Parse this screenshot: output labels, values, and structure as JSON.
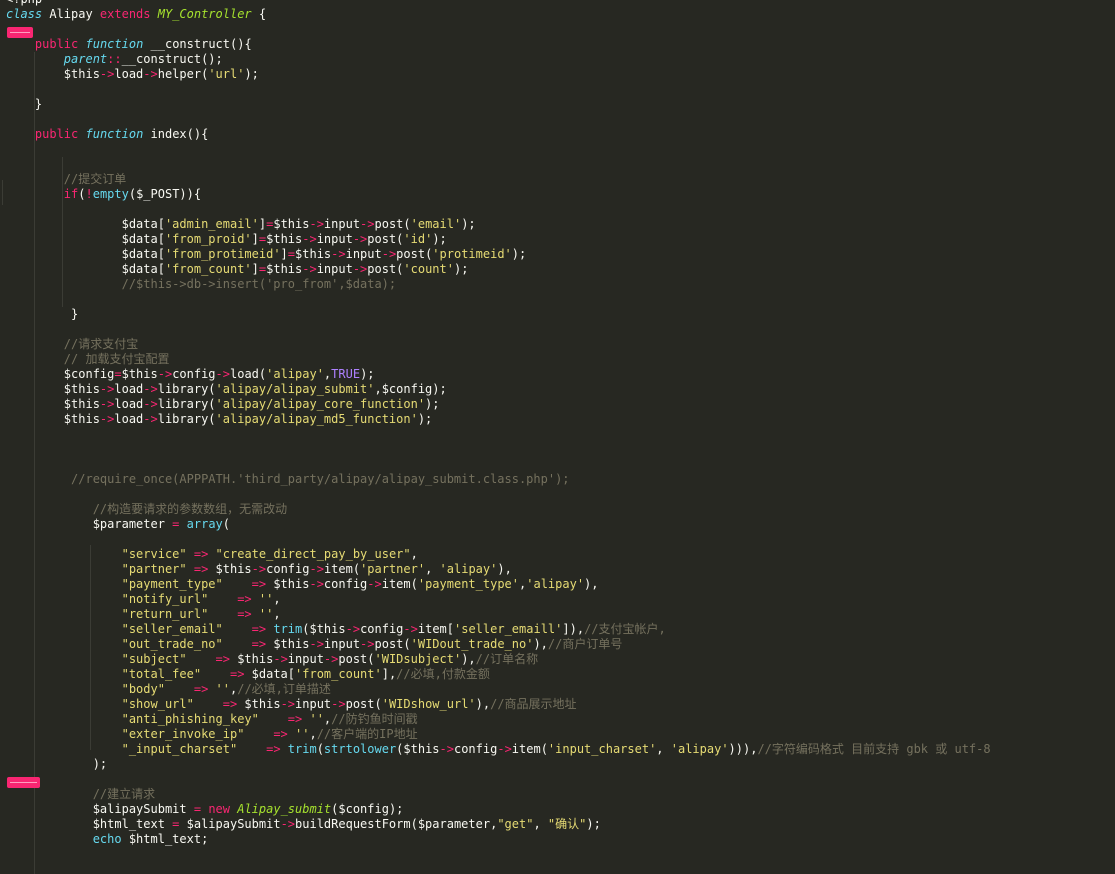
{
  "editor": {
    "language": "php",
    "colors": {
      "background": "#272822",
      "text": "#f8f8f2",
      "keyword": "#f92672",
      "storage": "#66d9ef",
      "class_name": "#a6e22e",
      "string": "#e6db74",
      "comment": "#75715e",
      "constant": "#ae81ff",
      "error_marker": "#f92672"
    },
    "error_markers": [
      {
        "line": 3
      },
      {
        "line": 53
      }
    ],
    "lines": [
      [
        [
          "t",
          "<?php"
        ]
      ],
      [
        [
          "st",
          "class"
        ],
        [
          "t",
          " Alipay "
        ],
        [
          "kw",
          "extends"
        ],
        [
          "t",
          " "
        ],
        [
          "cls",
          "MY_Controller"
        ],
        [
          "t",
          " {"
        ]
      ],
      [],
      [
        [
          "t",
          "    "
        ],
        [
          "kw",
          "public"
        ],
        [
          "t",
          " "
        ],
        [
          "st",
          "function"
        ],
        [
          "t",
          " __construct(){"
        ]
      ],
      [
        [
          "t",
          "        "
        ],
        [
          "st",
          "parent"
        ],
        [
          "op",
          "::"
        ],
        [
          "t",
          "__construct();"
        ]
      ],
      [
        [
          "t",
          "        $this"
        ],
        [
          "op",
          "->"
        ],
        [
          "t",
          "load"
        ],
        [
          "op",
          "->"
        ],
        [
          "t",
          "helper("
        ],
        [
          "str",
          "'url'"
        ],
        [
          "t",
          ");"
        ]
      ],
      [],
      [
        [
          "t",
          "    }"
        ]
      ],
      [],
      [
        [
          "t",
          "    "
        ],
        [
          "kw",
          "public"
        ],
        [
          "t",
          " "
        ],
        [
          "st",
          "function"
        ],
        [
          "t",
          " index(){"
        ]
      ],
      [],
      [],
      [
        [
          "t",
          "        "
        ],
        [
          "com",
          "//提交订单"
        ]
      ],
      [
        [
          "t",
          "        "
        ],
        [
          "kw",
          "if"
        ],
        [
          "t",
          "("
        ],
        [
          "op",
          "!"
        ],
        [
          "fn",
          "empty"
        ],
        [
          "t",
          "($_POST)){"
        ]
      ],
      [],
      [
        [
          "t",
          "                $data["
        ],
        [
          "str",
          "'admin_email'"
        ],
        [
          "t",
          "]"
        ],
        [
          "op",
          "="
        ],
        [
          "t",
          "$this"
        ],
        [
          "op",
          "->"
        ],
        [
          "t",
          "input"
        ],
        [
          "op",
          "->"
        ],
        [
          "t",
          "post("
        ],
        [
          "str",
          "'email'"
        ],
        [
          "t",
          ");"
        ]
      ],
      [
        [
          "t",
          "                $data["
        ],
        [
          "str",
          "'from_proid'"
        ],
        [
          "t",
          "]"
        ],
        [
          "op",
          "="
        ],
        [
          "t",
          "$this"
        ],
        [
          "op",
          "->"
        ],
        [
          "t",
          "input"
        ],
        [
          "op",
          "->"
        ],
        [
          "t",
          "post("
        ],
        [
          "str",
          "'id'"
        ],
        [
          "t",
          ");"
        ]
      ],
      [
        [
          "t",
          "                $data["
        ],
        [
          "str",
          "'from_protimeid'"
        ],
        [
          "t",
          "]"
        ],
        [
          "op",
          "="
        ],
        [
          "t",
          "$this"
        ],
        [
          "op",
          "->"
        ],
        [
          "t",
          "input"
        ],
        [
          "op",
          "->"
        ],
        [
          "t",
          "post("
        ],
        [
          "str",
          "'protimeid'"
        ],
        [
          "t",
          ");"
        ]
      ],
      [
        [
          "t",
          "                $data["
        ],
        [
          "str",
          "'from_count'"
        ],
        [
          "t",
          "]"
        ],
        [
          "op",
          "="
        ],
        [
          "t",
          "$this"
        ],
        [
          "op",
          "->"
        ],
        [
          "t",
          "input"
        ],
        [
          "op",
          "->"
        ],
        [
          "t",
          "post("
        ],
        [
          "str",
          "'count'"
        ],
        [
          "t",
          ");"
        ]
      ],
      [
        [
          "t",
          "                "
        ],
        [
          "com",
          "//$this->db->insert('pro_from',$data);"
        ]
      ],
      [],
      [
        [
          "t",
          "         }"
        ]
      ],
      [],
      [
        [
          "t",
          "        "
        ],
        [
          "com",
          "//请求支付宝"
        ]
      ],
      [
        [
          "t",
          "        "
        ],
        [
          "com",
          "// 加载支付宝配置"
        ]
      ],
      [
        [
          "t",
          "        $config"
        ],
        [
          "op",
          "="
        ],
        [
          "t",
          "$this"
        ],
        [
          "op",
          "->"
        ],
        [
          "t",
          "config"
        ],
        [
          "op",
          "->"
        ],
        [
          "t",
          "load("
        ],
        [
          "str",
          "'alipay'"
        ],
        [
          "t",
          ","
        ],
        [
          "const",
          "TRUE"
        ],
        [
          "t",
          ");"
        ]
      ],
      [
        [
          "t",
          "        $this"
        ],
        [
          "op",
          "->"
        ],
        [
          "t",
          "load"
        ],
        [
          "op",
          "->"
        ],
        [
          "t",
          "library("
        ],
        [
          "str",
          "'alipay/alipay_submit'"
        ],
        [
          "t",
          ",$config);"
        ]
      ],
      [
        [
          "t",
          "        $this"
        ],
        [
          "op",
          "->"
        ],
        [
          "t",
          "load"
        ],
        [
          "op",
          "->"
        ],
        [
          "t",
          "library("
        ],
        [
          "str",
          "'alipay/alipay_core_function'"
        ],
        [
          "t",
          ");"
        ]
      ],
      [
        [
          "t",
          "        $this"
        ],
        [
          "op",
          "->"
        ],
        [
          "t",
          "load"
        ],
        [
          "op",
          "->"
        ],
        [
          "t",
          "library("
        ],
        [
          "str",
          "'alipay/alipay_md5_function'"
        ],
        [
          "t",
          ");"
        ]
      ],
      [],
      [],
      [],
      [
        [
          "t",
          "         "
        ],
        [
          "com",
          "//require_once(APPPATH.'third_party/alipay/alipay_submit.class.php');"
        ]
      ],
      [],
      [
        [
          "t",
          "            "
        ],
        [
          "com",
          "//构造要请求的参数数组，无需改动"
        ]
      ],
      [
        [
          "t",
          "            $parameter "
        ],
        [
          "op",
          "="
        ],
        [
          "t",
          " "
        ],
        [
          "fn",
          "array"
        ],
        [
          "t",
          "("
        ]
      ],
      [],
      [
        [
          "t",
          "                "
        ],
        [
          "str",
          "\"service\""
        ],
        [
          "t",
          " "
        ],
        [
          "op",
          "=>"
        ],
        [
          "t",
          " "
        ],
        [
          "str",
          "\"create_direct_pay_by_user\""
        ],
        [
          "t",
          ","
        ]
      ],
      [
        [
          "t",
          "                "
        ],
        [
          "str",
          "\"partner\""
        ],
        [
          "t",
          " "
        ],
        [
          "op",
          "=>"
        ],
        [
          "t",
          " $this"
        ],
        [
          "op",
          "->"
        ],
        [
          "t",
          "config"
        ],
        [
          "op",
          "->"
        ],
        [
          "t",
          "item("
        ],
        [
          "str",
          "'partner'"
        ],
        [
          "t",
          ", "
        ],
        [
          "str",
          "'alipay'"
        ],
        [
          "t",
          "),"
        ]
      ],
      [
        [
          "t",
          "                "
        ],
        [
          "str",
          "\"payment_type\""
        ],
        [
          "t",
          "    "
        ],
        [
          "op",
          "=>"
        ],
        [
          "t",
          " $this"
        ],
        [
          "op",
          "->"
        ],
        [
          "t",
          "config"
        ],
        [
          "op",
          "->"
        ],
        [
          "t",
          "item("
        ],
        [
          "str",
          "'payment_type'"
        ],
        [
          "t",
          ","
        ],
        [
          "str",
          "'alipay'"
        ],
        [
          "t",
          "),"
        ]
      ],
      [
        [
          "t",
          "                "
        ],
        [
          "str",
          "\"notify_url\""
        ],
        [
          "t",
          "    "
        ],
        [
          "op",
          "=>"
        ],
        [
          "t",
          " "
        ],
        [
          "str",
          "''"
        ],
        [
          "t",
          ","
        ]
      ],
      [
        [
          "t",
          "                "
        ],
        [
          "str",
          "\"return_url\""
        ],
        [
          "t",
          "    "
        ],
        [
          "op",
          "=>"
        ],
        [
          "t",
          " "
        ],
        [
          "str",
          "''"
        ],
        [
          "t",
          ","
        ]
      ],
      [
        [
          "t",
          "                "
        ],
        [
          "str",
          "\"seller_email\""
        ],
        [
          "t",
          "    "
        ],
        [
          "op",
          "=>"
        ],
        [
          "t",
          " "
        ],
        [
          "fn",
          "trim"
        ],
        [
          "t",
          "($this"
        ],
        [
          "op",
          "->"
        ],
        [
          "t",
          "config"
        ],
        [
          "op",
          "->"
        ],
        [
          "t",
          "item["
        ],
        [
          "str",
          "'seller_emaill'"
        ],
        [
          "t",
          "]),"
        ],
        [
          "com",
          "//支付宝帐户,"
        ]
      ],
      [
        [
          "t",
          "                "
        ],
        [
          "str",
          "\"out_trade_no\""
        ],
        [
          "t",
          "    "
        ],
        [
          "op",
          "=>"
        ],
        [
          "t",
          " $this"
        ],
        [
          "op",
          "->"
        ],
        [
          "t",
          "input"
        ],
        [
          "op",
          "->"
        ],
        [
          "t",
          "post("
        ],
        [
          "str",
          "'WIDout_trade_no'"
        ],
        [
          "t",
          "),"
        ],
        [
          "com",
          "//商户订单号"
        ]
      ],
      [
        [
          "t",
          "                "
        ],
        [
          "str",
          "\"subject\""
        ],
        [
          "t",
          "    "
        ],
        [
          "op",
          "=>"
        ],
        [
          "t",
          " $this"
        ],
        [
          "op",
          "->"
        ],
        [
          "t",
          "input"
        ],
        [
          "op",
          "->"
        ],
        [
          "t",
          "post("
        ],
        [
          "str",
          "'WIDsubject'"
        ],
        [
          "t",
          "),"
        ],
        [
          "com",
          "//订单名称"
        ]
      ],
      [
        [
          "t",
          "                "
        ],
        [
          "str",
          "\"total_fee\""
        ],
        [
          "t",
          "    "
        ],
        [
          "op",
          "=>"
        ],
        [
          "t",
          " $data["
        ],
        [
          "str",
          "'from_count'"
        ],
        [
          "t",
          "],"
        ],
        [
          "com",
          "//必填,付款金额"
        ]
      ],
      [
        [
          "t",
          "                "
        ],
        [
          "str",
          "\"body\""
        ],
        [
          "t",
          "    "
        ],
        [
          "op",
          "=>"
        ],
        [
          "t",
          " "
        ],
        [
          "str",
          "''"
        ],
        [
          "t",
          ","
        ],
        [
          "com",
          "//必填,订单描述"
        ]
      ],
      [
        [
          "t",
          "                "
        ],
        [
          "str",
          "\"show_url\""
        ],
        [
          "t",
          "    "
        ],
        [
          "op",
          "=>"
        ],
        [
          "t",
          " $this"
        ],
        [
          "op",
          "->"
        ],
        [
          "t",
          "input"
        ],
        [
          "op",
          "->"
        ],
        [
          "t",
          "post("
        ],
        [
          "str",
          "'WIDshow_url'"
        ],
        [
          "t",
          "),"
        ],
        [
          "com",
          "//商品展示地址"
        ]
      ],
      [
        [
          "t",
          "                "
        ],
        [
          "str",
          "\"anti_phishing_key\""
        ],
        [
          "t",
          "    "
        ],
        [
          "op",
          "=>"
        ],
        [
          "t",
          " "
        ],
        [
          "str",
          "''"
        ],
        [
          "t",
          ","
        ],
        [
          "com",
          "//防钓鱼时间戳"
        ]
      ],
      [
        [
          "t",
          "                "
        ],
        [
          "str",
          "\"exter_invoke_ip\""
        ],
        [
          "t",
          "    "
        ],
        [
          "op",
          "=>"
        ],
        [
          "t",
          " "
        ],
        [
          "str",
          "''"
        ],
        [
          "t",
          ","
        ],
        [
          "com",
          "//客户端的IP地址"
        ]
      ],
      [
        [
          "t",
          "                "
        ],
        [
          "str",
          "\"_input_charset\""
        ],
        [
          "t",
          "    "
        ],
        [
          "op",
          "=>"
        ],
        [
          "t",
          " "
        ],
        [
          "fn",
          "trim"
        ],
        [
          "t",
          "("
        ],
        [
          "fn",
          "strtolower"
        ],
        [
          "t",
          "($this"
        ],
        [
          "op",
          "->"
        ],
        [
          "t",
          "config"
        ],
        [
          "op",
          "->"
        ],
        [
          "t",
          "item("
        ],
        [
          "str",
          "'input_charset'"
        ],
        [
          "t",
          ", "
        ],
        [
          "str",
          "'alipay'"
        ],
        [
          "t",
          "))),"
        ],
        [
          "com",
          "//字符编码格式 目前支持 gbk 或 utf-8"
        ]
      ],
      [
        [
          "t",
          "            );"
        ]
      ],
      [],
      [
        [
          "t",
          "            "
        ],
        [
          "com",
          "//建立请求"
        ]
      ],
      [
        [
          "t",
          "            $alipaySubmit "
        ],
        [
          "op",
          "="
        ],
        [
          "t",
          " "
        ],
        [
          "kw",
          "new"
        ],
        [
          "t",
          " "
        ],
        [
          "cls",
          "Alipay_submit"
        ],
        [
          "t",
          "($config);"
        ]
      ],
      [
        [
          "t",
          "            $html_text "
        ],
        [
          "op",
          "="
        ],
        [
          "t",
          " $alipaySubmit"
        ],
        [
          "op",
          "->"
        ],
        [
          "t",
          "buildRequestForm($parameter,"
        ],
        [
          "str",
          "\"get\""
        ],
        [
          "t",
          ", "
        ],
        [
          "str",
          "\"确认\""
        ],
        [
          "t",
          ");"
        ]
      ],
      [
        [
          "t",
          "            "
        ],
        [
          "fn",
          "echo"
        ],
        [
          "t",
          " $html_text;"
        ]
      ],
      []
    ]
  }
}
